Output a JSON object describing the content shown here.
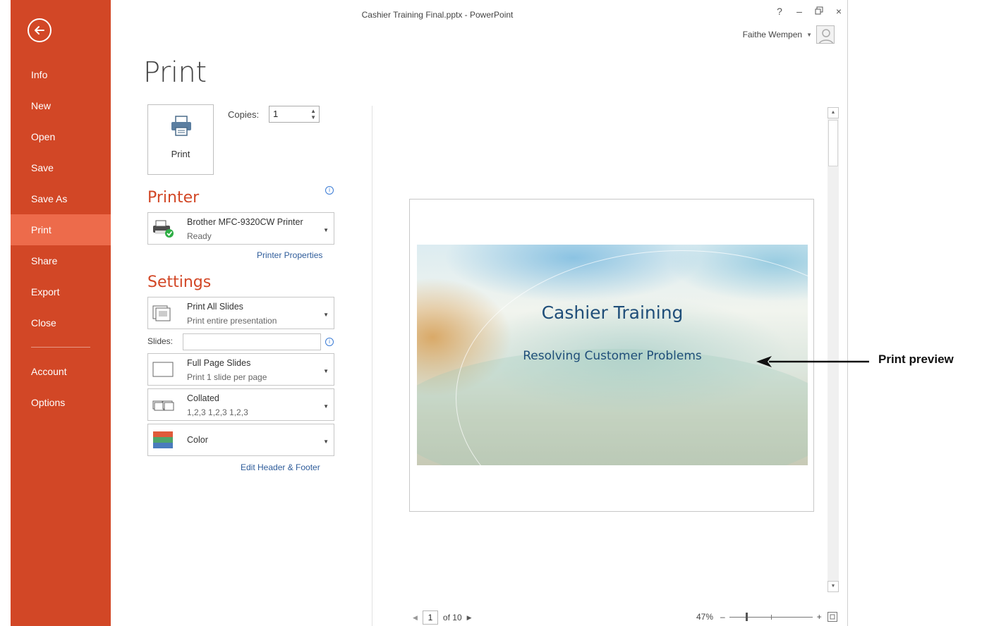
{
  "window": {
    "title": "Cashier Training Final.pptx - PowerPoint",
    "controls": [
      "?",
      "–",
      "🗗",
      "×"
    ],
    "user_name": "Faithe Wempen"
  },
  "sidebar": {
    "items": [
      {
        "label": "Info"
      },
      {
        "label": "New"
      },
      {
        "label": "Open"
      },
      {
        "label": "Save"
      },
      {
        "label": "Save As"
      },
      {
        "label": "Print",
        "active": true
      },
      {
        "label": "Share"
      },
      {
        "label": "Export"
      },
      {
        "label": "Close"
      },
      {
        "label": "Account"
      },
      {
        "label": "Options"
      }
    ],
    "accent": "#d24726",
    "active_color": "#ed6b4b"
  },
  "print_panel": {
    "heading": "Print",
    "print_button_label": "Print",
    "copies_label": "Copies:",
    "copies_value": "1",
    "printer_section": "Printer",
    "printer_name": "Brother MFC-9320CW Printer",
    "printer_status": "Ready",
    "printer_properties_link": "Printer Properties",
    "settings_section": "Settings",
    "slides_label": "Slides:",
    "slides_value": "",
    "edit_header_footer_link": "Edit Header & Footer",
    "settings": [
      {
        "line1": "Print All Slides",
        "line2": "Print entire presentation",
        "icon": "slides-stack-icon"
      },
      {
        "line1": "Full Page Slides",
        "line2": "Print 1 slide per page",
        "icon": "blank-page-icon"
      },
      {
        "line1": "Collated",
        "line2": "1,2,3   1,2,3   1,2,3",
        "icon": "collated-icon"
      },
      {
        "line1": "Color",
        "line2": "",
        "icon": "color-swatch-icon"
      }
    ]
  },
  "preview": {
    "slide_title": "Cashier Training",
    "slide_subtitle": "Resolving Customer Problems",
    "title_color": "#1f4e79"
  },
  "pager": {
    "current_page": "1",
    "total_text": "of 10"
  },
  "zoom": {
    "level_text": "47%",
    "minus": "–",
    "plus": "+",
    "slider_fraction": 0.2
  },
  "callout": {
    "label": "Print preview"
  }
}
